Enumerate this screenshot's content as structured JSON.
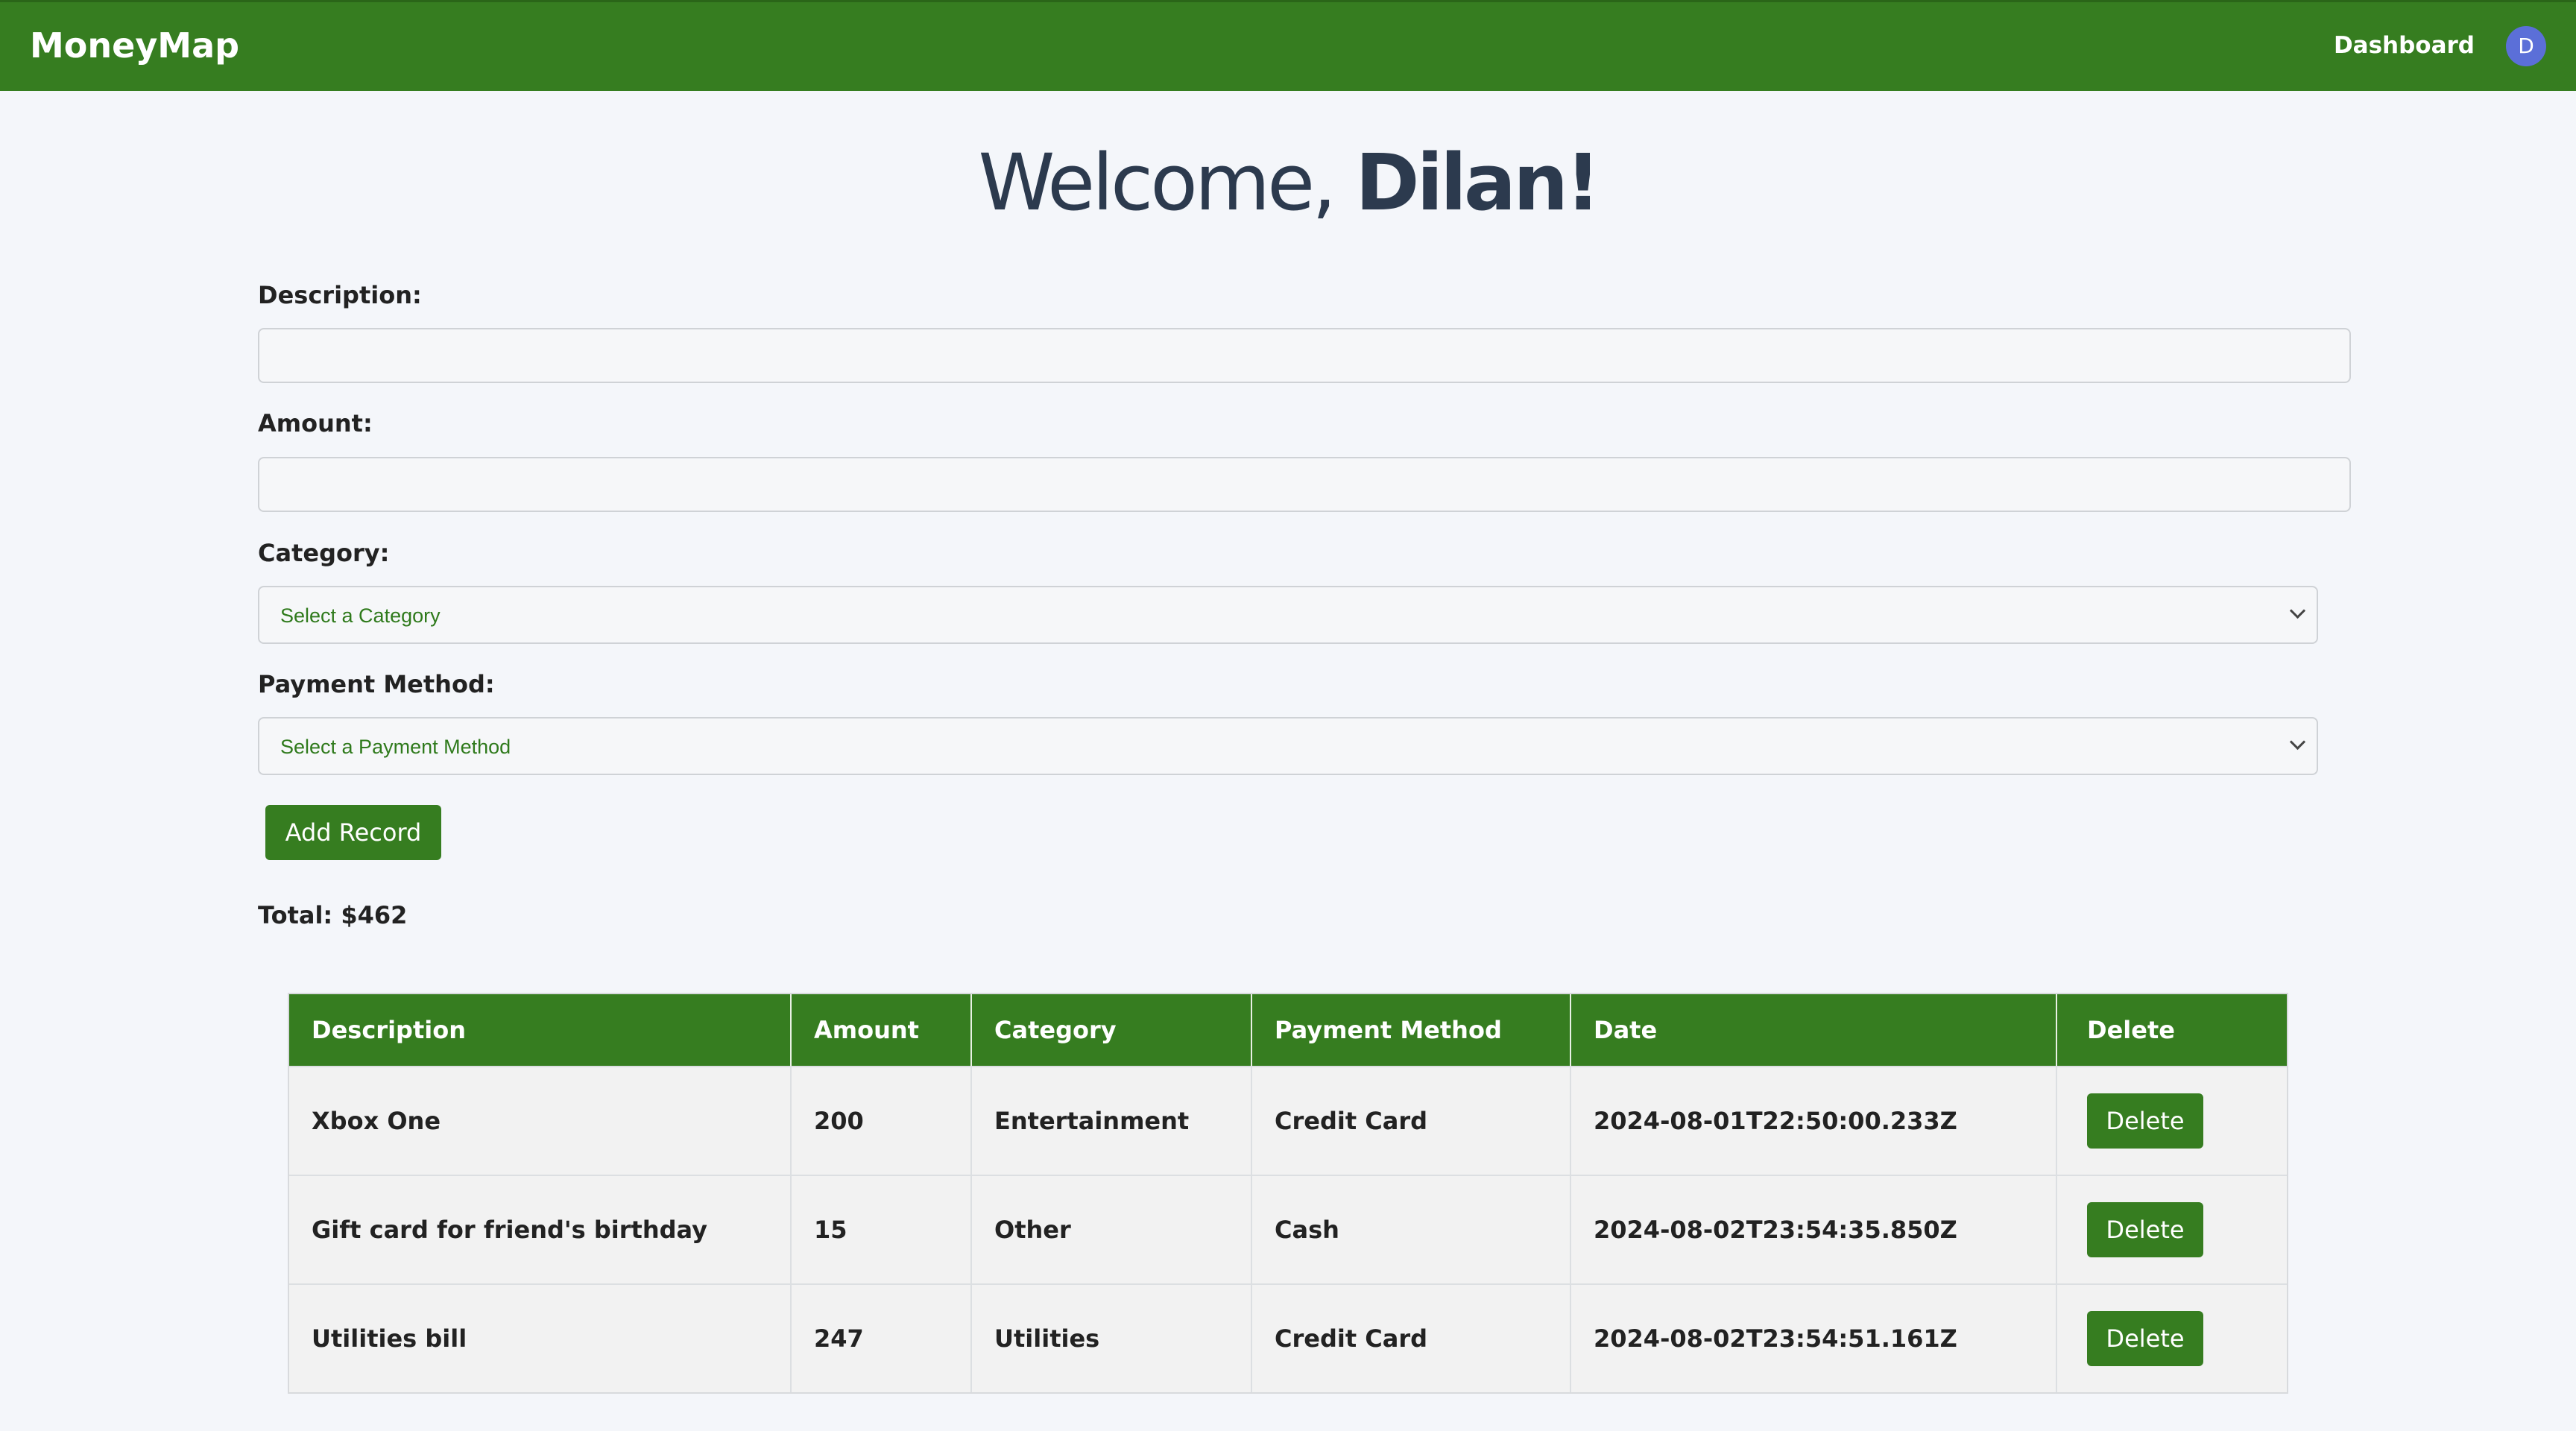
{
  "nav": {
    "brand": "MoneyMap",
    "dashboard_link": "Dashboard",
    "avatar_initial": "D"
  },
  "welcome": {
    "greeting": "Welcome,",
    "name": "Dilan!"
  },
  "form": {
    "description_label": "Description:",
    "description_value": "",
    "amount_label": "Amount:",
    "amount_value": "",
    "category_label": "Category:",
    "category_selected": "Select a Category",
    "payment_label": "Payment Method:",
    "payment_selected": "Select a Payment Method",
    "add_button": "Add Record"
  },
  "total": "Total: $462",
  "table": {
    "headers": [
      "Description",
      "Amount",
      "Category",
      "Payment Method",
      "Date",
      "Delete"
    ],
    "rows": [
      {
        "description": "Xbox One",
        "amount": "200",
        "category": "Entertainment",
        "payment": "Credit Card",
        "date": "2024-08-01T22:50:00.233Z",
        "delete": "Delete"
      },
      {
        "description": "Gift card for friend's birthday",
        "amount": "15",
        "category": "Other",
        "payment": "Cash",
        "date": "2024-08-02T23:54:35.850Z",
        "delete": "Delete"
      },
      {
        "description": "Utilities bill",
        "amount": "247",
        "category": "Utilities",
        "payment": "Credit Card",
        "date": "2024-08-02T23:54:51.161Z",
        "delete": "Delete"
      }
    ]
  },
  "colors": {
    "primary": "#367d20",
    "avatar": "#5b6fd8",
    "heading": "#2c3a4e",
    "background": "#f4f6fa"
  }
}
